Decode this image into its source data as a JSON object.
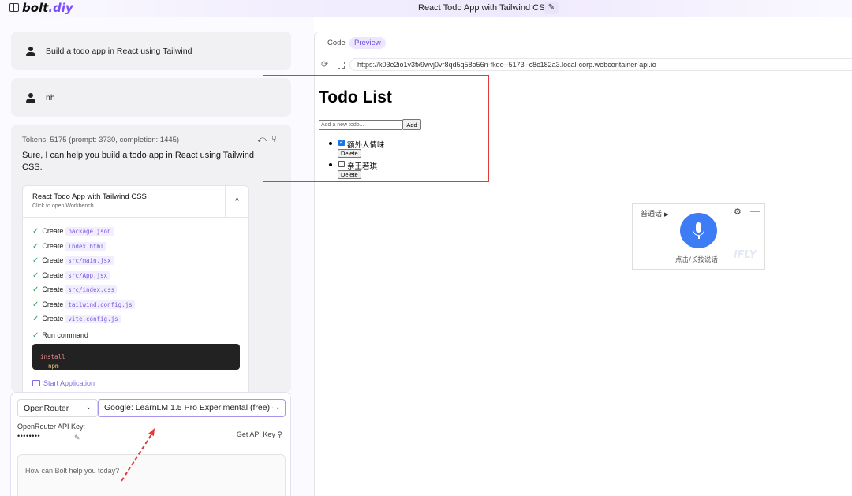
{
  "app": {
    "logo": "bolt.diy",
    "logo_main": "bolt",
    "logo_accent": ".diy",
    "window_title": "React Todo App with Tailwind CSS"
  },
  "chat": {
    "messages": [
      {
        "role": "user",
        "text": "Build a todo app in React using Tailwind"
      },
      {
        "role": "user",
        "text": "nh"
      }
    ],
    "assistant": {
      "tokens": "Tokens: 5175 (prompt: 3730, completion: 1445)",
      "reply": "Sure, I can help you build a todo app in React using Tailwind CSS.",
      "workbench": {
        "title": "React Todo App with Tailwind CSS",
        "subtitle": "Click to open Workbench",
        "actions": [
          {
            "verb": "Create",
            "file": "package.json"
          },
          {
            "verb": "Create",
            "file": "index.html"
          },
          {
            "verb": "Create",
            "file": "src/main.jsx"
          },
          {
            "verb": "Create",
            "file": "src/App.jsx"
          },
          {
            "verb": "Create",
            "file": "src/index.css"
          },
          {
            "verb": "Create",
            "file": "tailwind.config.js"
          },
          {
            "verb": "Create",
            "file": "vite.config.js"
          }
        ],
        "run_command_label": "Run command",
        "command": "npm install",
        "command_bin": "npm",
        "command_arg": "install",
        "start_label": "Start Application"
      }
    }
  },
  "input": {
    "provider": "OpenRouter",
    "model": "Google: LearnLM 1.5 Pro Experimental (free) - ",
    "api_key_label": "OpenRouter API Key:",
    "api_key_value": "••••••••",
    "get_key_label": "Get API Key",
    "placeholder": "How can Bolt help you today?"
  },
  "workspace": {
    "tabs": [
      "Code",
      "Preview"
    ],
    "active_tab": "Preview",
    "url": "https://k03e2io1v3fx9wvj0vr8qd5q58o56n-fkdo--5173--c8c182a3.local-corp.webcontainer-api.io",
    "preview": {
      "heading": "Todo List",
      "input_placeholder": "Add a new todo...",
      "add_label": "Add",
      "delete_label": "Delete",
      "todos": [
        {
          "text": "额外人情味",
          "done": true
        },
        {
          "text": "亲王若琪",
          "done": false
        }
      ]
    }
  },
  "voice_widget": {
    "language": "普通话",
    "hint": "点击/长按说话",
    "brand": "iFLY"
  },
  "colors": {
    "accent": "#7c4dff",
    "mic_blue": "#3d7cf4",
    "annotation_red": "#e53935",
    "check_green": "#22a35a"
  }
}
